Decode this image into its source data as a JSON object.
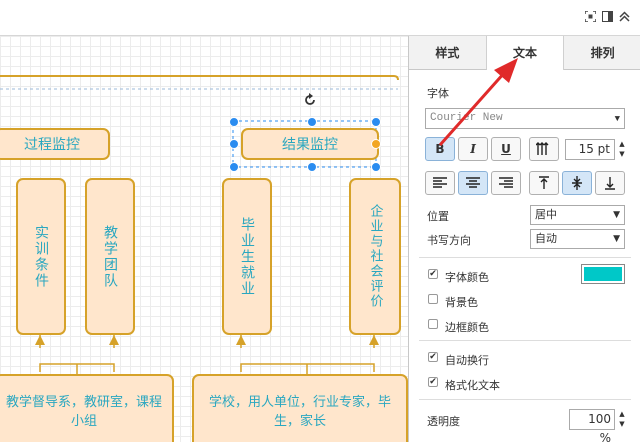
{
  "panel": {
    "tabs": [
      {
        "label": "样式"
      },
      {
        "label": "文本"
      },
      {
        "label": "排列"
      }
    ],
    "font_section_label": "字体",
    "font_family": {
      "value": "Courier New"
    },
    "style_buttons": {
      "bold": "B",
      "italic": "I",
      "underline": "U"
    },
    "font_size": {
      "value": "15 pt"
    },
    "position": {
      "label": "位置",
      "value": "居中"
    },
    "writing_direction": {
      "label": "书写方向",
      "value": "自动"
    },
    "checks": [
      {
        "label": "字体颜色",
        "checked": true
      },
      {
        "label": "背景色",
        "checked": false
      },
      {
        "label": "边框颜色",
        "checked": false
      },
      {
        "label": "自动换行",
        "checked": true
      },
      {
        "label": "格式化文本",
        "checked": true
      }
    ],
    "font_color": "#00c8c8",
    "opacity": {
      "label": "透明度",
      "value": "100 %"
    }
  },
  "diagram": {
    "colors": {
      "fill": "#ffe6cc",
      "stroke": "#d6a229",
      "text": "#2aa7c0",
      "selection": "#2a8cf0",
      "arrow": "#e02a2a"
    },
    "nodes": {
      "process_monitor": "过程监控",
      "result_monitor": "结果监控",
      "training_conditions": "实训条件",
      "teaching_team": "教学团队",
      "graduate_employment": "毕业生就业",
      "enterprise_evaluation": "企业与社会评价",
      "teaching_supervision": "教学督导系，教研室，课程小组",
      "school_stakeholders": "学校，用人单位，行业专家，毕生，家长"
    }
  }
}
